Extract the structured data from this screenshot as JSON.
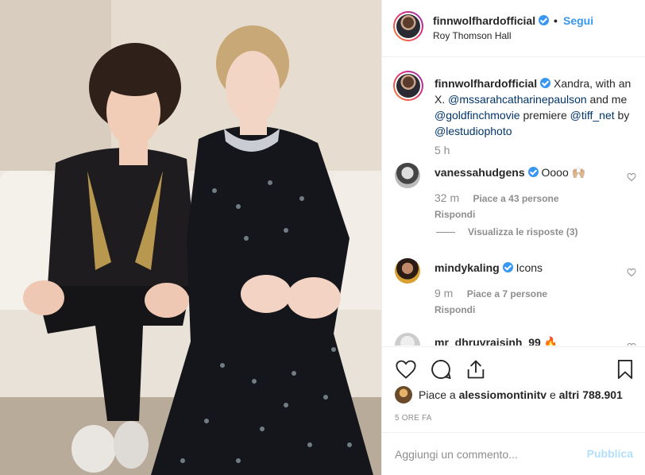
{
  "header": {
    "username": "finnwolfhardofficial",
    "separator": "•",
    "follow_label": "Segui",
    "location": "Roy Thomson Hall"
  },
  "caption": {
    "username": "finnwolfhardofficial",
    "text_1": " Xandra, with an X. ",
    "mention_1": "@mssarahcatharinepaulson",
    "text_2": " and me ",
    "mention_2": "@goldfinchmovie",
    "text_3": " premiere ",
    "mention_3": "@tiff_net",
    "text_4": " by ",
    "mention_4": "@lestudiophoto",
    "time": "5 h"
  },
  "comments": [
    {
      "username": "vanessahudgens",
      "verified": true,
      "text": "Oooo 🙌🏼",
      "time": "32 m",
      "likes": "Piace a 43 persone",
      "reply": "Rispondi"
    },
    {
      "username": "mindykaling",
      "verified": true,
      "text": "Icons",
      "time": "9 m",
      "likes": "Piace a 7 persone",
      "reply": "Rispondi"
    },
    {
      "username": "mr_dhruvraisinh_99",
      "verified": false,
      "text": "🔥",
      "time": "",
      "likes": "",
      "reply": ""
    }
  ],
  "view_replies": "Visualizza le risposte (3)",
  "actions": {
    "like_icon": "heart-icon",
    "comment_icon": "comment-icon",
    "share_icon": "share-icon",
    "save_icon": "bookmark-icon",
    "likes_prefix": "Piace a ",
    "likes_user": "alessiomontinitv",
    "likes_middle": " e ",
    "likes_rest": "altri 788.901",
    "post_age": "5 ORE FA"
  },
  "add_comment": {
    "placeholder": "Aggiungi un commento...",
    "publish_label": "Pubblica"
  },
  "colors": {
    "accent": "#3897f0",
    "publish_disabled": "#b2dffc",
    "muted": "#8e8e8e",
    "mention": "#003569"
  }
}
